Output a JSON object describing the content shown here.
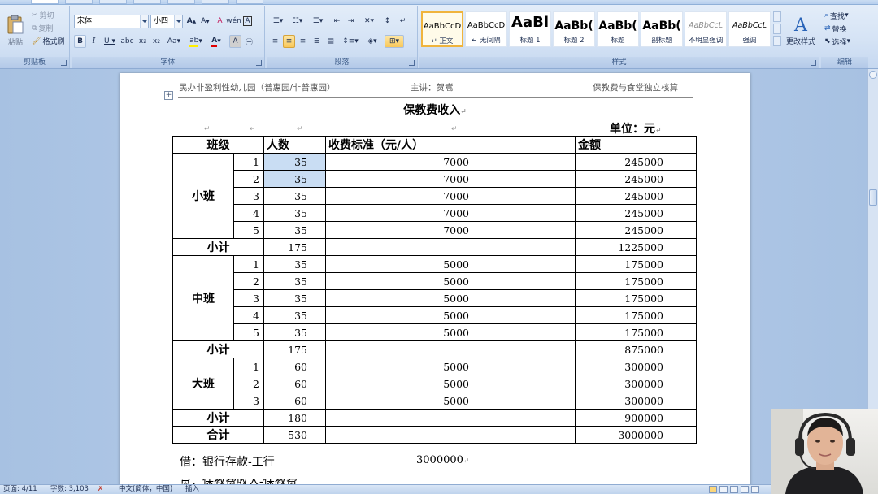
{
  "ribbon": {
    "clipboard": {
      "paste": "粘贴",
      "cut": "剪切",
      "copy": "复制",
      "format_painter": "格式刷",
      "label": "剪贴板"
    },
    "font": {
      "name": "宋体",
      "size": "小四",
      "label": "字体"
    },
    "paragraph": {
      "label": "段落"
    },
    "styles": {
      "label": "样式",
      "items": [
        {
          "sample": "AaBbCcD",
          "name": "↵ 正文"
        },
        {
          "sample": "AaBbCcD",
          "name": "↵ 无间隔"
        },
        {
          "sample": "AaBl",
          "name": "标题 1"
        },
        {
          "sample": "AaBb(",
          "name": "标题 2"
        },
        {
          "sample": "AaBb(",
          "name": "标题"
        },
        {
          "sample": "AaBb(",
          "name": "副标题"
        },
        {
          "sample": "AaBbCcL",
          "name": "不明显强调"
        },
        {
          "sample": "AaBbCcL",
          "name": "强调"
        }
      ],
      "change_styles": "更改样式"
    },
    "editing": {
      "find": "查找",
      "replace": "替换",
      "select": "选择",
      "label": "编辑"
    }
  },
  "document": {
    "header": {
      "left": "民办非盈利性幼儿园（普惠园/非普惠园）",
      "center": "主讲：贺嵩",
      "right": "保教费与食堂独立核算"
    },
    "title": "保教费收入",
    "unit": "单位：元",
    "table": {
      "columns": [
        "班级",
        "人数",
        "收费标准（元/人）",
        "金额"
      ],
      "groups": [
        {
          "name": "小班",
          "rows": [
            {
              "idx": "1",
              "count": "35",
              "rate": "7000",
              "amount": "245000"
            },
            {
              "idx": "2",
              "count": "35",
              "rate": "7000",
              "amount": "245000"
            },
            {
              "idx": "3",
              "count": "35",
              "rate": "7000",
              "amount": "245000"
            },
            {
              "idx": "4",
              "count": "35",
              "rate": "7000",
              "amount": "245000"
            },
            {
              "idx": "5",
              "count": "35",
              "rate": "7000",
              "amount": "245000"
            }
          ],
          "subtotal_label": "小计",
          "subtotal_count": "175",
          "subtotal_amount": "1225000"
        },
        {
          "name": "中班",
          "rows": [
            {
              "idx": "1",
              "count": "35",
              "rate": "5000",
              "amount": "175000"
            },
            {
              "idx": "2",
              "count": "35",
              "rate": "5000",
              "amount": "175000"
            },
            {
              "idx": "3",
              "count": "35",
              "rate": "5000",
              "amount": "175000"
            },
            {
              "idx": "4",
              "count": "35",
              "rate": "5000",
              "amount": "175000"
            },
            {
              "idx": "5",
              "count": "35",
              "rate": "5000",
              "amount": "175000"
            }
          ],
          "subtotal_label": "小计",
          "subtotal_count": "175",
          "subtotal_amount": "875000"
        },
        {
          "name": "大班",
          "rows": [
            {
              "idx": "1",
              "count": "60",
              "rate": "5000",
              "amount": "300000"
            },
            {
              "idx": "2",
              "count": "60",
              "rate": "5000",
              "amount": "300000"
            },
            {
              "idx": "3",
              "count": "60",
              "rate": "5000",
              "amount": "300000"
            }
          ],
          "subtotal_label": "小计",
          "subtotal_count": "180",
          "subtotal_amount": "900000"
        }
      ],
      "total": {
        "label": "合计",
        "count": "530",
        "amount": "3000000"
      }
    },
    "entry": {
      "text": "借：银行存款-工行",
      "amount": "3000000"
    }
  },
  "statusbar": {
    "page": "页面: 4/11",
    "words": "字数: 3,103",
    "language": "中文(简体，中国)",
    "mode": "插入"
  }
}
